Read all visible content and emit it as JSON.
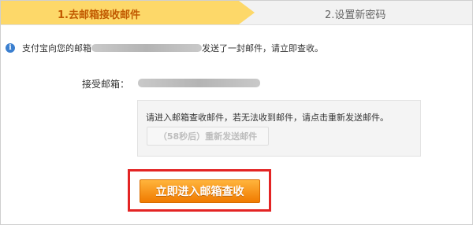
{
  "steps": [
    {
      "label": "1.去邮箱接收邮件",
      "active": true
    },
    {
      "label": "2.设置新密码",
      "active": false
    }
  ],
  "info": {
    "prefix": "支付宝向您的邮箱",
    "suffix": "发送了一封邮件，请立即查收。",
    "icon": "info-icon"
  },
  "receive": {
    "label": "接受邮箱："
  },
  "notice": {
    "text": "请进入邮箱查收邮件，若无法收到邮件，请点击重新发送邮件。",
    "resend_label": "（58秒后）重新发送邮件"
  },
  "cta": {
    "label": "立即进入邮箱查收"
  },
  "colors": {
    "active_step_bg": "#fdd869",
    "active_step_text": "#c25a00",
    "cta_orange": "#f07b00",
    "highlight_red": "#e32424"
  }
}
